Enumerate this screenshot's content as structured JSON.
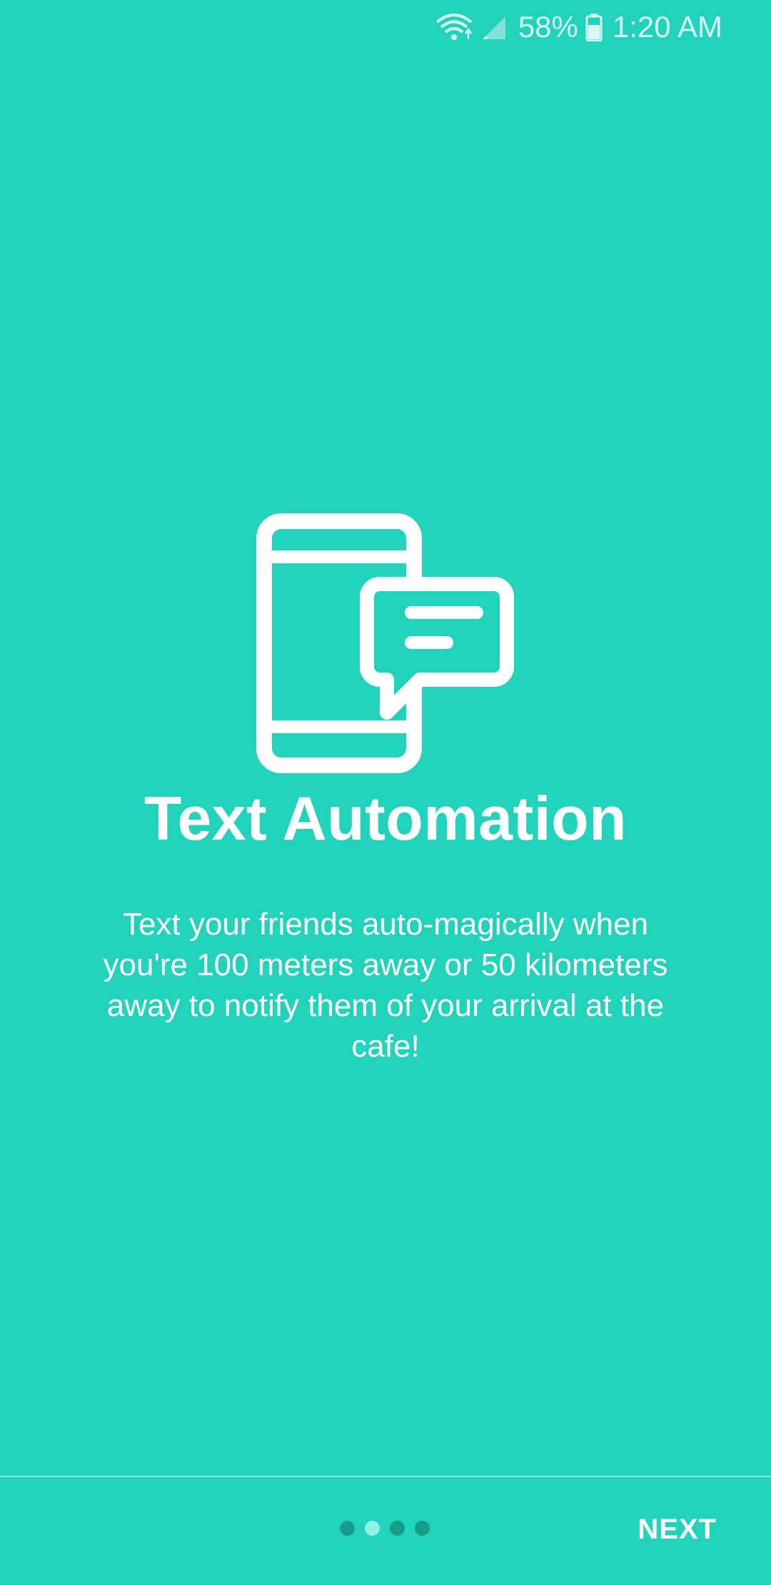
{
  "status_bar": {
    "battery": "58%",
    "time": "1:20 AM",
    "icons": [
      "wifi-icon",
      "cell-signal-icon",
      "battery-icon"
    ]
  },
  "onboarding": {
    "icon": "phone-message-icon",
    "title": "Text Automation",
    "description": "Text your friends auto-magically when you're 100 meters away or 50 kilometers away to notify them of your arrival at the cafe!",
    "pages": {
      "total": 4,
      "active": 2
    }
  },
  "footer": {
    "next_label": "NEXT"
  },
  "colors": {
    "background": "#22d3bc",
    "dot_inactive": "#169c8a",
    "dot_active": "#8ff2e3",
    "text": "#ffffff"
  }
}
